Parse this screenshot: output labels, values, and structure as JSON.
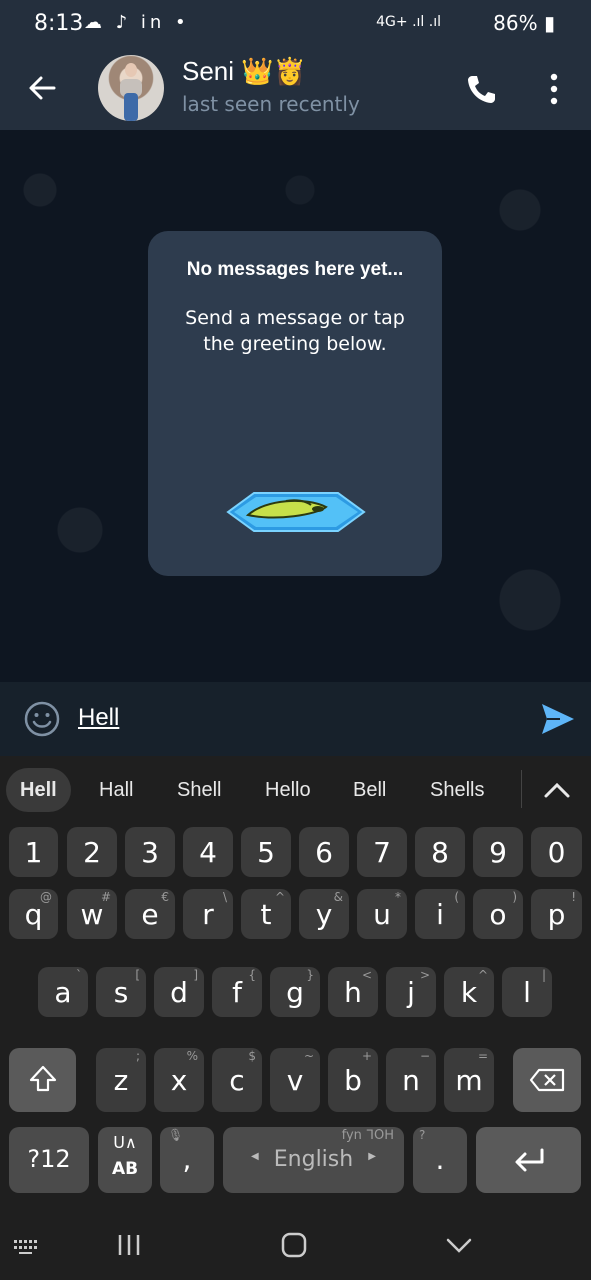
{
  "status_bar": {
    "time": "8:13",
    "left_icons": "☁ ♪ in •",
    "signal": "4G+ .ıl .ıl",
    "battery": "86%"
  },
  "header": {
    "contact_name": "Seni 👑👸",
    "status": "last seen recently"
  },
  "chat": {
    "empty_title": "No messages here yet...",
    "empty_text": "Send a message or tap the greeting below."
  },
  "input": {
    "value": "Hell"
  },
  "keyboard": {
    "suggestions": [
      "Hell",
      "Hall",
      "Shell",
      "Hello",
      "Bell",
      "Shells"
    ],
    "row_numbers": [
      "1",
      "2",
      "3",
      "4",
      "5",
      "6",
      "7",
      "8",
      "9",
      "0"
    ],
    "row1": [
      [
        "q",
        "@"
      ],
      [
        "w",
        "#"
      ],
      [
        "e",
        "€"
      ],
      [
        "r",
        "\\"
      ],
      [
        "t",
        "^"
      ],
      [
        "y",
        "&"
      ],
      [
        "u",
        "*"
      ],
      [
        "i",
        "("
      ],
      [
        "o",
        ")"
      ],
      [
        "p",
        "!"
      ]
    ],
    "row2": [
      [
        "a",
        "`"
      ],
      [
        "s",
        "["
      ],
      [
        "d",
        "]"
      ],
      [
        "f",
        "{"
      ],
      [
        "g",
        "}"
      ],
      [
        "h",
        "<"
      ],
      [
        "j",
        ">"
      ],
      [
        "k",
        "^"
      ],
      [
        "l",
        "|"
      ]
    ],
    "row3": [
      [
        "z",
        ";"
      ],
      [
        "x",
        "%"
      ],
      [
        "c",
        "$"
      ],
      [
        "v",
        "~"
      ],
      [
        "b",
        "+"
      ],
      [
        "n",
        "−"
      ],
      [
        "m",
        "="
      ]
    ],
    "symbols_label": "?12",
    "lang_switch_top": "ᑌ∧",
    "lang_switch_bottom": "AB",
    "comma": ",",
    "space_label": "English",
    "space_hint": "fyn ᒣOᕼ",
    "period": ".",
    "period_hint": "?"
  },
  "colors": {
    "accent": "#5eb5f7",
    "header_bg": "#242f3d",
    "chat_bg": "#0e1621",
    "key_bg": "#3b3b3b"
  }
}
